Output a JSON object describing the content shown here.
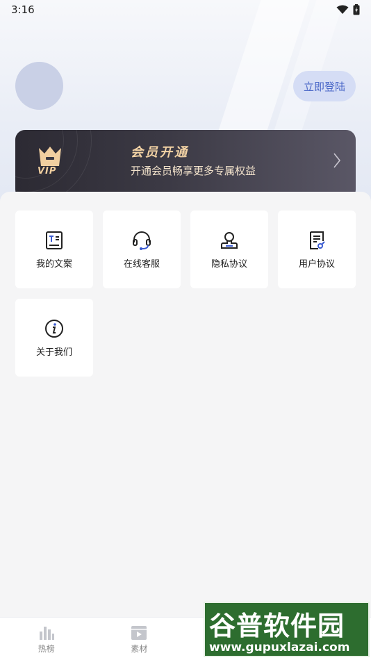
{
  "status_bar": {
    "time": "3:16",
    "icons": [
      "wifi-icon",
      "battery-charging-icon"
    ]
  },
  "profile": {
    "login_label": "立即登陆"
  },
  "vip_card": {
    "badge_text": "VIP",
    "title": "会员开通",
    "subtitle": "开通会员畅享更多专属权益",
    "accent_color": "#f2d2a4"
  },
  "menu": {
    "items": [
      {
        "label": "我的文案",
        "icon": "document-text-icon"
      },
      {
        "label": "在线客服",
        "icon": "headset-icon"
      },
      {
        "label": "隐私协议",
        "icon": "user-shield-icon"
      },
      {
        "label": "用户协议",
        "icon": "agreement-icon"
      },
      {
        "label": "关于我们",
        "icon": "info-icon"
      }
    ]
  },
  "tabbar": {
    "items": [
      {
        "label": "热榜",
        "icon": "bar-chart-icon"
      },
      {
        "label": "素材",
        "icon": "media-icon"
      },
      {
        "label": "",
        "icon": "create-icon"
      },
      {
        "label": "",
        "icon": "profile-icon"
      }
    ],
    "active_color": "#4a67c8"
  },
  "watermark": {
    "title": "谷普软件园",
    "url": "www.gupuxlazai.com"
  }
}
